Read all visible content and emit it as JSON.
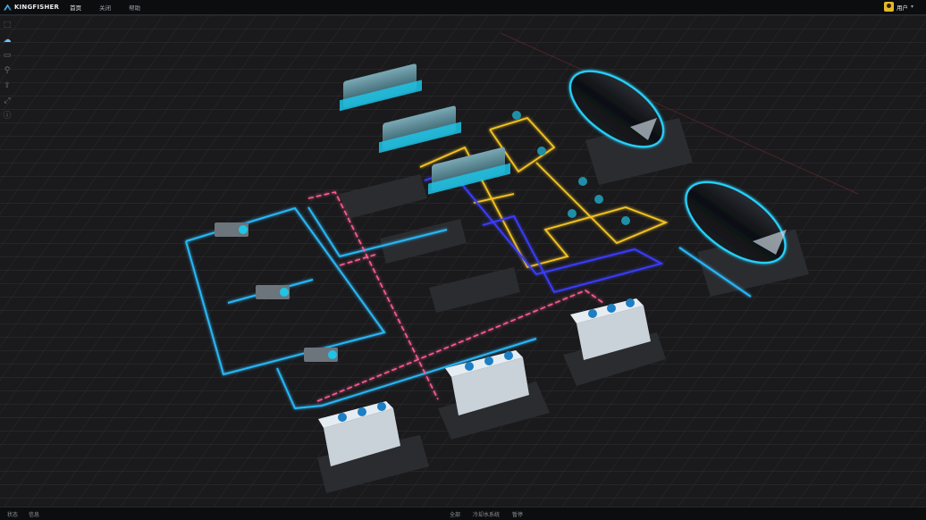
{
  "app": {
    "brand": "KINGFISHER"
  },
  "nav": {
    "items": [
      "首页",
      "关闭",
      "帮助"
    ],
    "active_index": 0
  },
  "user": {
    "name": "用户"
  },
  "toolbar": {
    "tools": [
      "select-icon",
      "layer-icon",
      "rectangle-icon",
      "pin-icon",
      "export-icon",
      "fullscreen-icon",
      "info-icon"
    ],
    "active_index": 1
  },
  "statusbar": {
    "left": [
      "状态",
      "信息"
    ],
    "center": [
      "全部",
      "冷却水系统",
      "暂停"
    ]
  },
  "scene": {
    "colors": {
      "chilled_water": "#29b6f6",
      "hot_water": "#ff5c93",
      "condenser_water": "#f4c321",
      "return_line": "#3a3cff",
      "tank_glow": "#27d3ff"
    },
    "equipment": [
      "chiller-1",
      "chiller-2",
      "chiller-3",
      "pump-1",
      "pump-2",
      "pump-3",
      "cooling-tower-1",
      "cooling-tower-2",
      "cooling-tower-3",
      "tank-1",
      "tank-2"
    ]
  }
}
